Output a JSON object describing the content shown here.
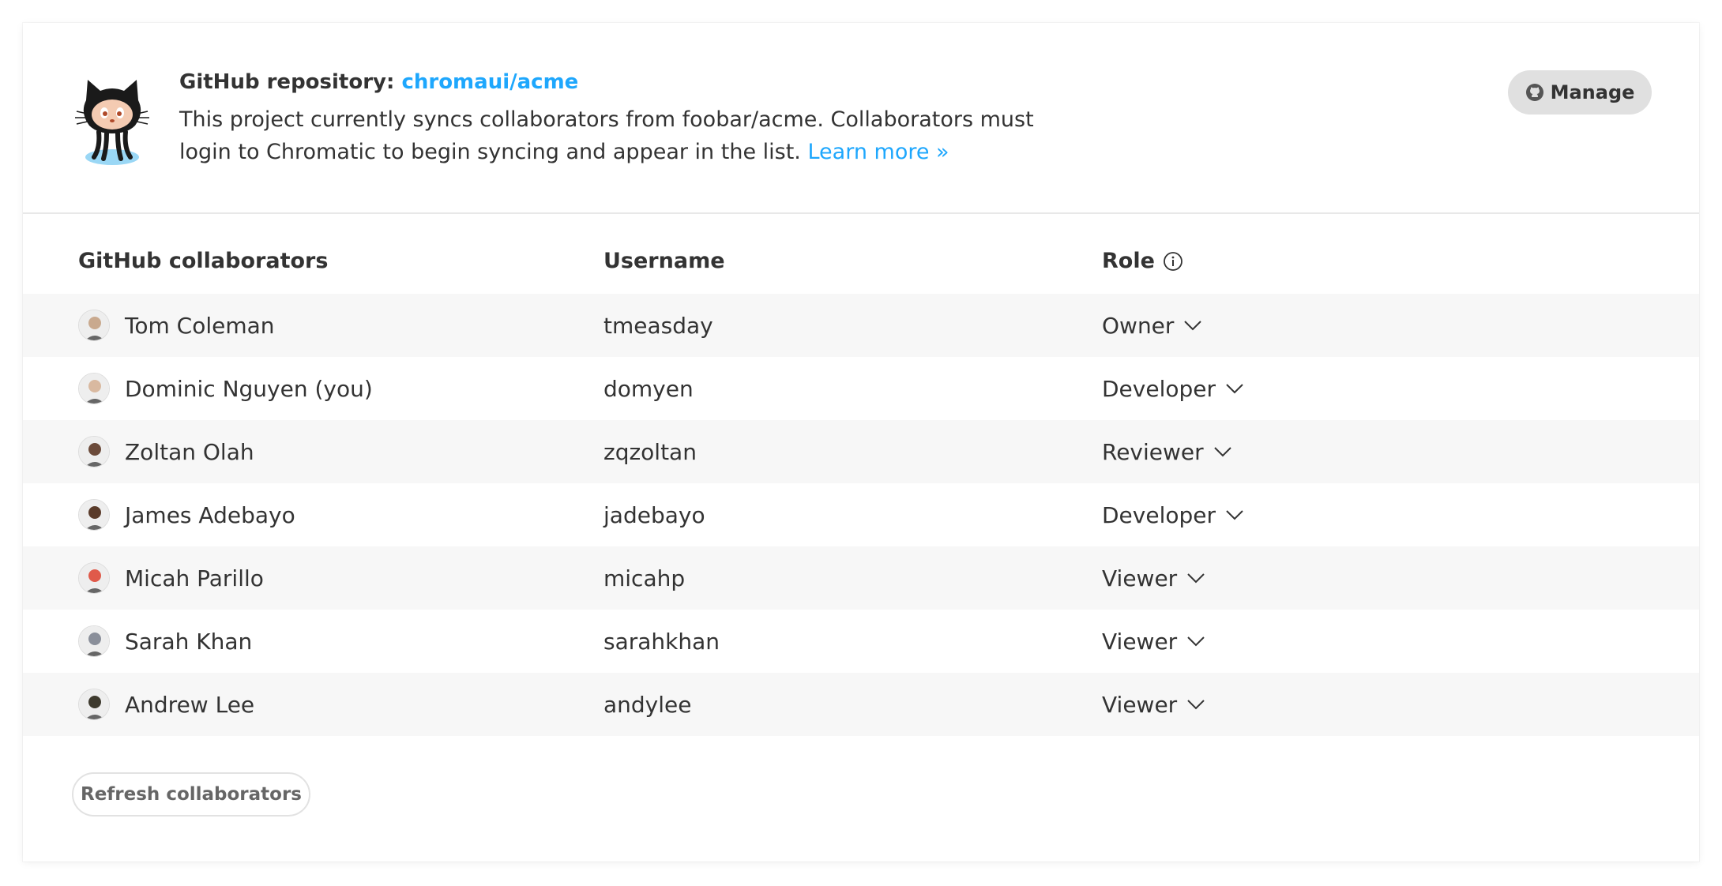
{
  "repo": {
    "label": "GitHub repository:",
    "name": "chromaui/acme",
    "description": "This project currently syncs collaborators from foobar/acme. Collaborators must login to Chromatic to begin syncing and appear in the list.",
    "learn_more": "Learn more »",
    "manage_label": "Manage"
  },
  "table": {
    "headers": {
      "name": "GitHub collaborators",
      "username": "Username",
      "role": "Role"
    },
    "rows": [
      {
        "name": "Tom Coleman",
        "username": "tmeasday",
        "role": "Owner",
        "avatar_color": "#c9a98e"
      },
      {
        "name": "Dominic Nguyen (you)",
        "username": "domyen",
        "role": "Developer",
        "avatar_color": "#d9b9a0"
      },
      {
        "name": "Zoltan Olah",
        "username": "zqzoltan",
        "role": "Reviewer",
        "avatar_color": "#6b4a3a"
      },
      {
        "name": "James Adebayo",
        "username": "jadebayo",
        "role": "Developer",
        "avatar_color": "#5a3b2a"
      },
      {
        "name": "Micah Parillo",
        "username": "micahp",
        "role": "Viewer",
        "avatar_color": "#e05a4a"
      },
      {
        "name": "Sarah Khan",
        "username": "sarahkhan",
        "role": "Viewer",
        "avatar_color": "#8a8f9a"
      },
      {
        "name": "Andrew Lee",
        "username": "andylee",
        "role": "Viewer",
        "avatar_color": "#3e3a2e"
      }
    ]
  },
  "refresh_label": "Refresh collaborators",
  "colors": {
    "link": "#1ea7fd",
    "text": "#333333",
    "row_stripe": "#f7f7f7",
    "manage_bg": "#e0e0e0"
  }
}
